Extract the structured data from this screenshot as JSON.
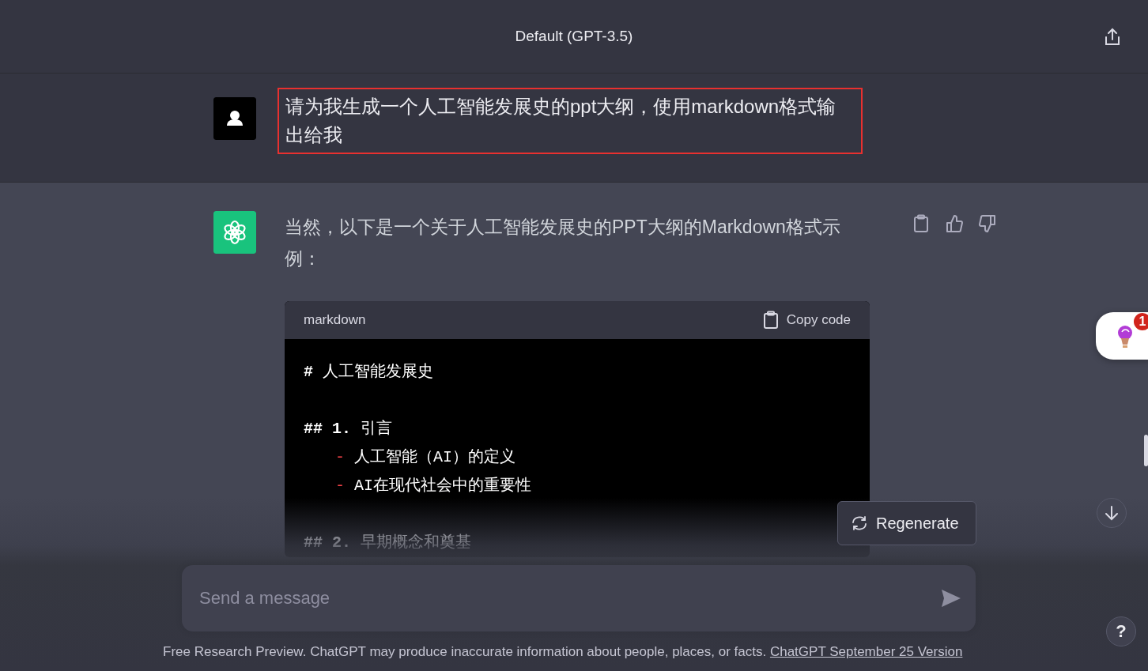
{
  "header": {
    "title": "Default (GPT-3.5)"
  },
  "user_message": {
    "text": "请为我生成一个人工智能发展史的ppt大纲，使用markdown格式输出给我",
    "highlighted": true
  },
  "assistant_message": {
    "text": "当然，以下是一个关于人工智能发展史的PPT大纲的Markdown格式示例："
  },
  "code_block": {
    "language": "markdown",
    "copy_label": "Copy code",
    "lines": [
      {
        "kind": "heading",
        "marker": "#",
        "text": "人工智能发展史"
      },
      {
        "kind": "blank"
      },
      {
        "kind": "heading",
        "marker": "## 1.",
        "text": "引言"
      },
      {
        "kind": "bullet",
        "marker": "-",
        "text": "人工智能（AI）的定义"
      },
      {
        "kind": "bullet",
        "marker": "-",
        "text": "AI在现代社会中的重要性"
      },
      {
        "kind": "blank"
      },
      {
        "kind": "heading",
        "marker": "## 2.",
        "text": "早期概念和奠基"
      }
    ]
  },
  "regenerate_button": "Regenerate",
  "composer": {
    "placeholder": "Send a message"
  },
  "footer": {
    "text": "Free Research Preview. ChatGPT may produce inaccurate information about people, places, or facts.",
    "link": "ChatGPT September 25 Version"
  },
  "plugin_widget": {
    "badge": "1"
  },
  "help_button": "?"
}
